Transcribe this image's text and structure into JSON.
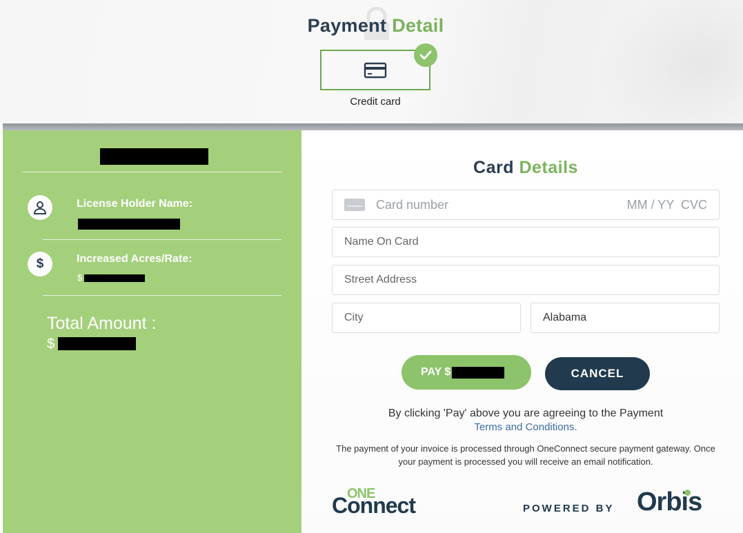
{
  "header": {
    "title_main": "Payment",
    "title_accent": "Detail",
    "payment_method": {
      "label": "Credit card",
      "icon": "credit-card-icon",
      "selected_badge_icon": "check-circle-icon"
    }
  },
  "summary": {
    "license_holder_label": "License Holder Name:",
    "increased_acres_label": "Increased Acres/Rate:",
    "increased_acres_prefix": "$",
    "total_label": "Total Amount :",
    "total_prefix": "$",
    "icons": [
      "user-icon",
      "dollar-icon"
    ]
  },
  "card_form": {
    "title_main": "Card",
    "title_accent": "Details",
    "card_number_placeholder": "Card number",
    "expiry_cvc_placeholder": "MM / YY  CVC",
    "name_placeholder": "Name On Card",
    "street_placeholder": "Street Address",
    "city_placeholder": "City",
    "state_value": "Alabama"
  },
  "actions": {
    "pay_label": "PAY $",
    "cancel_label": "CANCEL"
  },
  "footer": {
    "agree_text": "By clicking 'Pay' above you are agreeing to the Payment",
    "terms_link": "Terms and Conditions.",
    "gateway_text": "The payment of your invoice is processed through OneConnect secure payment gateway. Once your payment is processed you will receive an email notification.",
    "logo_one": "ONE",
    "logo_connect": "Connect",
    "powered_by": "POWERED BY",
    "orbis": "Orbis"
  },
  "colors": {
    "accent_green": "#7ab35c",
    "panel_green": "#a4cf7b",
    "navy": "#213a4d"
  }
}
